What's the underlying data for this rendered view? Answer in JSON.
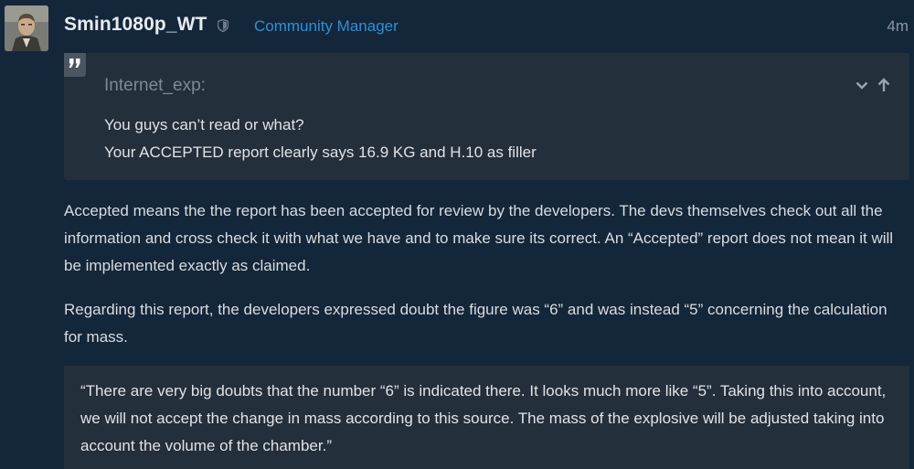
{
  "post": {
    "username": "Smin1080p_WT",
    "user_title": "Community Manager",
    "time": "4m",
    "avatar_icon": "user-avatar",
    "badge_icon": "shield-icon",
    "quote": {
      "icon": "quote-icon",
      "author": "Internet_exp:",
      "lines": [
        "You guys can’t read or what?",
        "Your ACCEPTED report clearly says 16.9 KG and H.10 as filler"
      ],
      "controls": [
        "chevron-down-icon",
        "arrow-up-icon"
      ]
    },
    "paragraphs": [
      "Accepted means the the report has been accepted for review by the developers. The devs themselves check out all the information and cross check it with what we have and to make sure its correct. An “Accepted” report does not mean it will be implemented exactly as claimed.",
      "Regarding this report, the developers expressed doubt the figure was “6” and was instead “5” concerning the calculation for mass."
    ],
    "blockquote": "“There are very big doubts that the number “6” is indicated there. It looks much more like “5”. Taking this into account, we will not accept the change in mass according to this source. The mass of the explosive will be adjusted taking into account the volume of the chamber.”"
  },
  "colors": {
    "background": "#14263a",
    "panel": "#232f3b",
    "accent": "#2e8fd6",
    "muted": "#8a96a3"
  }
}
